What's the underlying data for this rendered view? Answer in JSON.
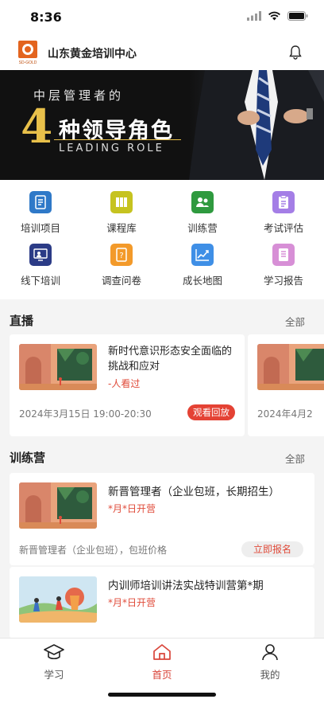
{
  "status": {
    "time": "8:36"
  },
  "header": {
    "title": "山东黄金培训中心",
    "logo_text": "SD-GOLD"
  },
  "banner": {
    "line1": "中层管理者的",
    "number": "4",
    "main": "种领导角色",
    "sub": "LEADING ROLE"
  },
  "grid": [
    {
      "label": "培训项目",
      "icon": "document-icon",
      "color": "#2f79c8"
    },
    {
      "label": "课程库",
      "icon": "books-icon",
      "color": "#c6c320"
    },
    {
      "label": "训练营",
      "icon": "users-icon",
      "color": "#2f9a3f"
    },
    {
      "label": "考试评估",
      "icon": "clipboard-icon",
      "color": "#a47ee6"
    },
    {
      "label": "线下培训",
      "icon": "presentation-icon",
      "color": "#2b3b86"
    },
    {
      "label": "调查问卷",
      "icon": "survey-icon",
      "color": "#f39a2a"
    },
    {
      "label": "成长地图",
      "icon": "growth-chart-icon",
      "color": "#3f8fe6"
    },
    {
      "label": "学习报告",
      "icon": "report-icon",
      "color": "#d78fd6"
    }
  ],
  "live": {
    "title": "直播",
    "more": "全部",
    "cards": [
      {
        "title": "新时代意识形态安全面临的挑战和应对",
        "sub": "-人看过",
        "date": "2024年3月15日 19:00-20:30",
        "button": "观看回放"
      },
      {
        "title": "",
        "sub": "",
        "date": "2024年4月2",
        "button": ""
      }
    ]
  },
  "camp": {
    "title": "训练营",
    "more": "全部",
    "items": [
      {
        "title": "新晋管理者（企业包班，长期招生）",
        "sub": "*月*日开营",
        "meta": "新晋管理者（企业包班），包班价格",
        "button": "立即报名"
      },
      {
        "title": "内训师培训讲法实战特训营第*期",
        "sub": "*月*日开营",
        "meta": "",
        "button": ""
      }
    ]
  },
  "tabs": [
    {
      "label": "学习",
      "icon": "graduation-cap-icon"
    },
    {
      "label": "首页",
      "icon": "home-icon"
    },
    {
      "label": "我的",
      "icon": "person-icon"
    }
  ]
}
